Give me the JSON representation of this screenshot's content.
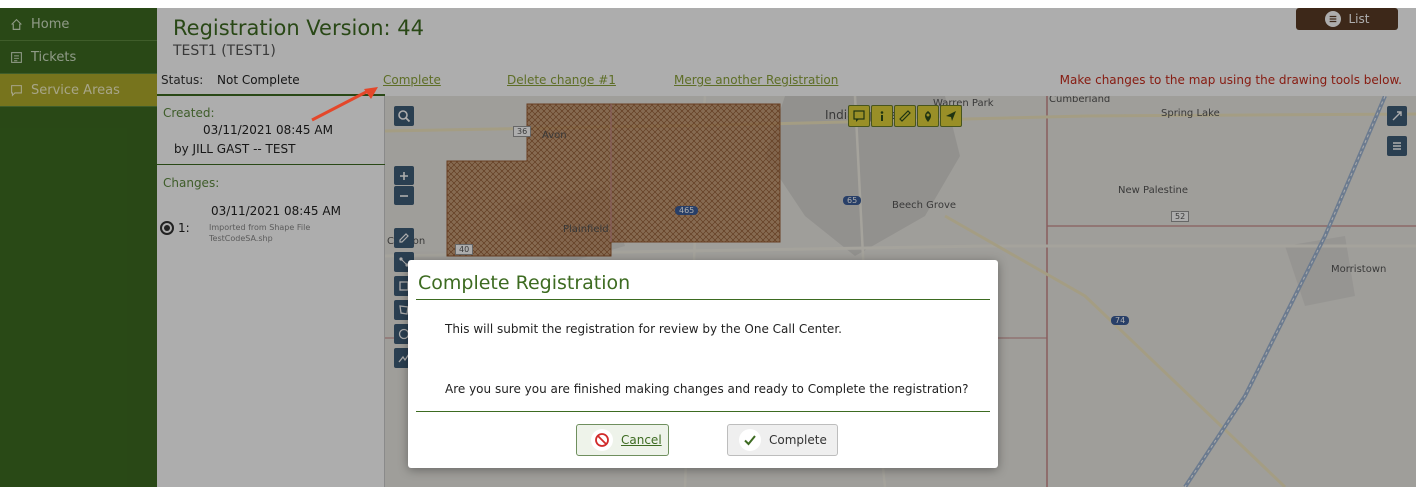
{
  "sidebar": {
    "items": [
      {
        "label": "Home",
        "icon": "home-icon",
        "active": false
      },
      {
        "label": "Tickets",
        "icon": "tickets-icon",
        "active": false
      },
      {
        "label": "Service Areas",
        "icon": "service-areas-icon",
        "active": true
      }
    ]
  },
  "header": {
    "title": "Registration Version: 44",
    "subtitle": "TEST1 (TEST1)",
    "list_button": "List",
    "status_label": "Status:",
    "status_value": "Not Complete",
    "links": {
      "complete": "Complete",
      "delete_change": "Delete change #1",
      "merge": "Merge another Registration"
    },
    "map_hint": "Make changes to the map using the drawing tools below."
  },
  "info": {
    "created_label": "Created:",
    "created_date": "03/11/2021 08:45 AM",
    "created_by": "by JILL GAST -- TEST",
    "changes_label": "Changes:",
    "changes": [
      {
        "num": "1:",
        "date": "03/11/2021 08:45 AM",
        "desc": "Imported from Shape File TestCodeSA.shp",
        "selected": true
      }
    ]
  },
  "map": {
    "labels": {
      "avon": "Avon",
      "plainfield": "Plainfield",
      "indianapolis": "Indianapolis",
      "warren_park": "Warren Park",
      "beech_grove": "Beech Grove",
      "cumberland": "Cumberland",
      "spring_lake": "Spring Lake",
      "new_palestine": "New Palestine",
      "morristown": "Morristown",
      "clayton": "Clayton",
      "route_36": "36",
      "route_465": "465",
      "route_65": "65",
      "route_52": "52",
      "route_74": "74",
      "route_40": "40"
    },
    "area_color": "#b3733f"
  },
  "dialog": {
    "title": "Complete Registration",
    "message1": "This will submit the registration for review by the One Call Center.",
    "message2": "Are you sure you are finished making changes and ready to Complete the registration?",
    "cancel_label": "Cancel",
    "complete_label": "Complete"
  },
  "colors": {
    "brand_green": "#3d6b21",
    "active_nav": "#b0ab2c",
    "hint_red": "#c72b1c",
    "list_brown": "#5b3c26"
  }
}
